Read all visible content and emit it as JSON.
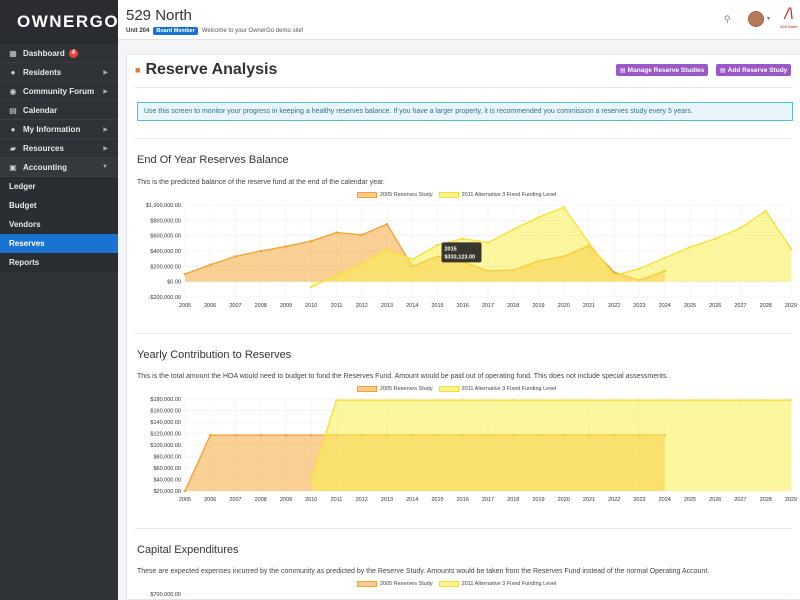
{
  "brand": {
    "name": "OWNERGO"
  },
  "sidebar": {
    "main": [
      {
        "label": "Dashboard",
        "icon": "dashboard-icon",
        "glyph": "▦",
        "badge": "4",
        "caret": ""
      },
      {
        "label": "Residents",
        "icon": "person-icon",
        "glyph": "●",
        "badge": "",
        "caret": "▶"
      },
      {
        "label": "Community Forum",
        "icon": "chat-icon",
        "glyph": "◉",
        "badge": "",
        "caret": "▶"
      },
      {
        "label": "Calendar",
        "icon": "calendar-icon",
        "glyph": "▤",
        "badge": "",
        "caret": ""
      },
      {
        "label": "My Information",
        "icon": "user-icon",
        "glyph": "●",
        "badge": "",
        "caret": "▶"
      },
      {
        "label": "Resources",
        "icon": "briefcase-icon",
        "glyph": "▰",
        "badge": "",
        "caret": "▶"
      },
      {
        "label": "Accounting",
        "icon": "accounting-icon",
        "glyph": "▣",
        "badge": "",
        "caret": "▼"
      }
    ],
    "sub": [
      "Ledger",
      "Budget",
      "Vendors",
      "Reserves",
      "Reports"
    ],
    "active_sub": "Reserves"
  },
  "header": {
    "title": "529 North",
    "unit": "Unit 204",
    "role": "Board Member",
    "welcome": "Welcome to your OwnerGo demo site!",
    "org_logo_text": "529 North"
  },
  "page": {
    "title": "Reserve Analysis",
    "manage_label": "Manage Reserve Studies",
    "add_label": "Add Reserve Study",
    "info": "Use this screen to monitor your progress in keeping a healthy reserves balance. If you have a larger property, it is recommended you commission a reserves study every 5 years."
  },
  "colors": {
    "series1": "#f5a93f",
    "series2": "#f7e84a",
    "accent": "#1a73d0",
    "button": "#9b58c9"
  },
  "sections": [
    {
      "title": "End Of Year Reserves Balance",
      "desc": "This is the predicted balance of the reserve fund at the end of the calendar year."
    },
    {
      "title": "Yearly Contribution to Reserves",
      "desc": "This is the total amount the HOA would need to budget to fund the Reserves Fund. Amount would be paid out of operating fund. This does not include special assessments."
    },
    {
      "title": "Capital Expenditures",
      "desc": "These are expected expenses incurred by the community as predicted by the Reserve Study. Amounts would be taken from the Reserves Fund instead of the normal Operating Account."
    }
  ],
  "chart_data": [
    {
      "type": "area",
      "title": "End Of Year Reserves Balance",
      "x": [
        "2005",
        "2006",
        "2007",
        "2008",
        "2009",
        "2010",
        "2011",
        "2012",
        "2013",
        "2014",
        "2015",
        "2016",
        "2017",
        "2018",
        "2019",
        "2020",
        "2021",
        "2022",
        "2023",
        "2024",
        "2025",
        "2026",
        "2027",
        "2028",
        "2029"
      ],
      "ylim": [
        -200000,
        1000000
      ],
      "yticks": [
        "$1,000,000.00",
        "$800,000.00",
        "$600,000.00",
        "$400,000.00",
        "$200,000.00",
        "$0.00",
        "-$200,000.00"
      ],
      "series": [
        {
          "name": "2005 Reserves Study",
          "values": [
            100000,
            220000,
            330000,
            400000,
            460000,
            530000,
            640000,
            610000,
            750000,
            200000,
            330000,
            260000,
            140000,
            150000,
            270000,
            330000,
            470000,
            120000,
            20000,
            140000,
            null,
            null,
            null,
            null,
            null
          ]
        },
        {
          "name": "2011 Alternative 3 Fixed Funding Level",
          "values": [
            null,
            null,
            null,
            null,
            null,
            -70000,
            80000,
            230000,
            420000,
            290000,
            480000,
            560000,
            510000,
            680000,
            840000,
            970000,
            500000,
            80000,
            170000,
            310000,
            450000,
            560000,
            700000,
            920000,
            430000
          ]
        }
      ],
      "tooltip": {
        "label": "2015",
        "value": "$333,123.00"
      }
    },
    {
      "type": "area",
      "title": "Yearly Contribution to Reserves",
      "x": [
        "2005",
        "2006",
        "2007",
        "2008",
        "2009",
        "2010",
        "2011",
        "2012",
        "2013",
        "2014",
        "2015",
        "2016",
        "2017",
        "2018",
        "2019",
        "2020",
        "2021",
        "2022",
        "2023",
        "2024",
        "2025",
        "2026",
        "2027",
        "2028",
        "2029"
      ],
      "ylim": [
        20000,
        180000
      ],
      "yticks": [
        "$180,000.00",
        "$160,000.00",
        "$140,000.00",
        "$120,000.00",
        "$100,000.00",
        "$80,000.00",
        "$60,000.00",
        "$40,000.00",
        "$20,000.00"
      ],
      "series": [
        {
          "name": "2005 Reserves Study",
          "values": [
            20000,
            117000,
            117000,
            117000,
            117000,
            117000,
            117000,
            117000,
            117000,
            117000,
            117000,
            117000,
            117000,
            117000,
            117000,
            117000,
            117000,
            117000,
            117000,
            117000,
            null,
            null,
            null,
            null,
            null
          ]
        },
        {
          "name": "2011 Alternative 3 Fixed Funding Level",
          "values": [
            null,
            null,
            null,
            null,
            null,
            40000,
            178000,
            178000,
            178000,
            178000,
            178000,
            178000,
            178000,
            178000,
            178000,
            178000,
            178000,
            178000,
            178000,
            178000,
            178000,
            178000,
            178000,
            178000,
            178000
          ]
        }
      ]
    },
    {
      "type": "area",
      "title": "Capital Expenditures",
      "yticks": [
        "$700,000.00"
      ],
      "series": [
        {
          "name": "2005 Reserves Study",
          "values": []
        },
        {
          "name": "2011 Alternative 3 Fixed Funding Level",
          "values": []
        }
      ]
    }
  ]
}
